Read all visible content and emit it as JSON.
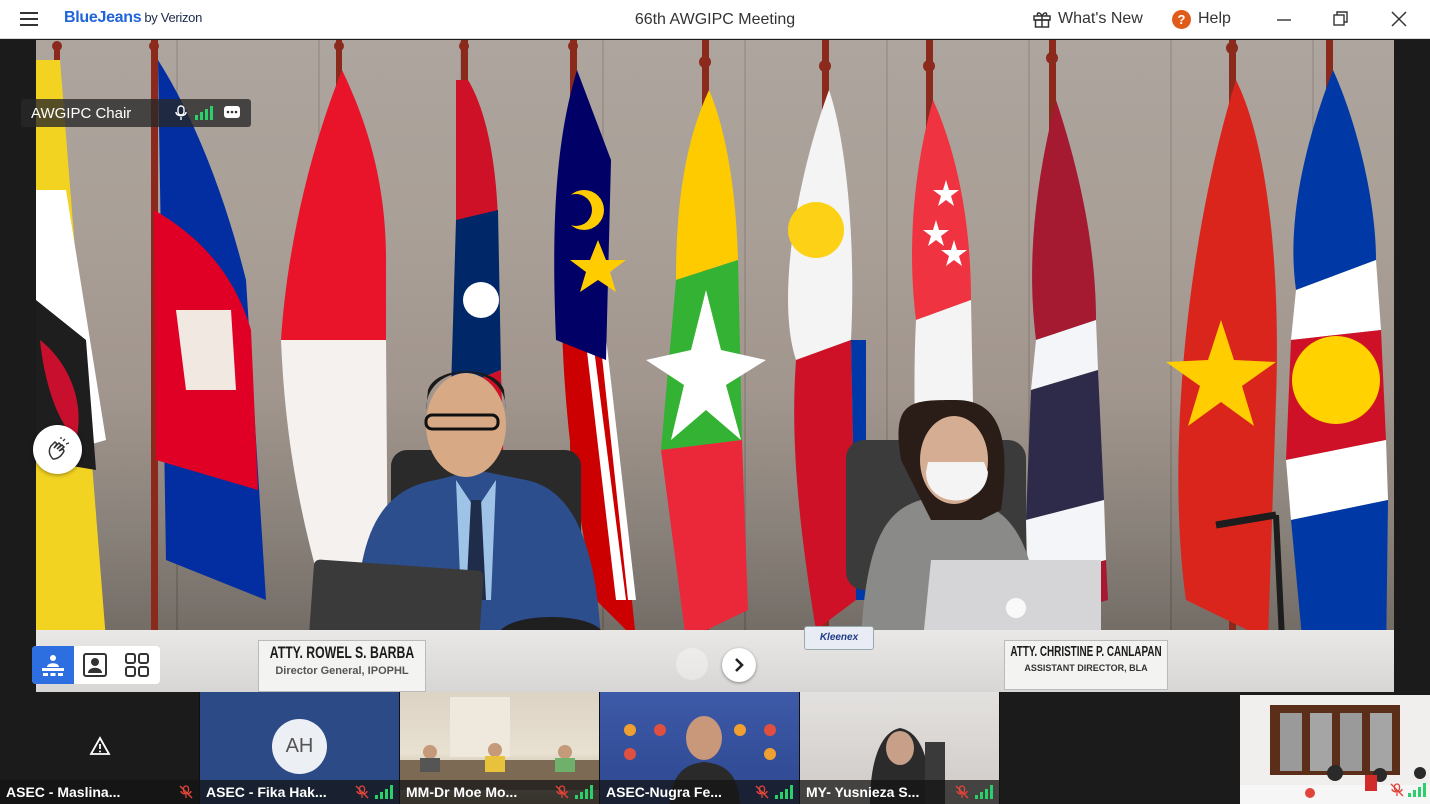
{
  "titlebar": {
    "brand": "BlueJeans",
    "brand_sub": "by Verizon",
    "meeting_title": "66th AWGIPC Meeting",
    "whats_new": "What's New",
    "help": "Help",
    "help_glyph": "?"
  },
  "speaker": {
    "label": "AWGIPC Chair"
  },
  "scene": {
    "nameplate_left": {
      "name": "ATTY. ROWEL S. BARBA",
      "title": "Director General, IPOPHL"
    },
    "nameplate_right": {
      "name": "ATTY. CHRISTINE P. CANLAPAN",
      "title": "ASSISTANT DIRECTOR, BLA"
    },
    "tissue_brand": "Kleenex"
  },
  "participants": [
    {
      "name": "ASEC - Maslina...",
      "video": "off-warning"
    },
    {
      "name": "ASEC - Fika Hak...",
      "video": "avatar",
      "initials": "AH"
    },
    {
      "name": "MM-Dr Moe Mo...",
      "video": "on"
    },
    {
      "name": "ASEC-Nugra Fe...",
      "video": "on"
    },
    {
      "name": "MY- Yusnieza S...",
      "video": "on"
    }
  ],
  "colors": {
    "brand_blue": "#1f64d8",
    "active_layout": "#2d6fe0",
    "signal_green": "#2bd06b",
    "muted_red": "#e0443a",
    "help_orange": "#e05a1a"
  },
  "icons": [
    "hamburger-icon",
    "gift-icon",
    "help-icon",
    "minimize-icon",
    "restore-icon",
    "close-icon",
    "microphone-icon",
    "signal-icon",
    "chat-icon",
    "clap-icon",
    "speaker-layout-icon",
    "people-layout-icon",
    "gallery-layout-icon",
    "chevron-right-icon",
    "muted-mic-icon",
    "warning-icon"
  ]
}
